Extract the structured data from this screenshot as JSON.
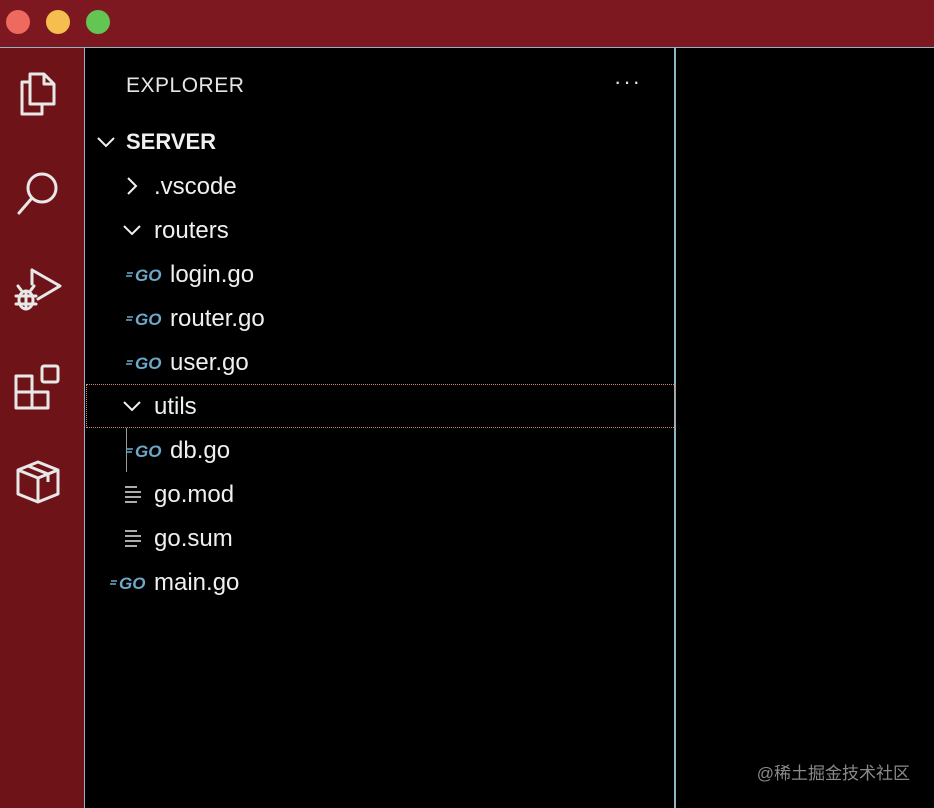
{
  "window": {
    "traffic_lights": [
      "close",
      "minimize",
      "maximize"
    ],
    "colors": {
      "titlebar": "#7d1820",
      "activitybar": "#6e1418",
      "accent_border": "#8fb4c8"
    }
  },
  "activity_bar": {
    "items": [
      {
        "name": "files-icon"
      },
      {
        "name": "search-icon"
      },
      {
        "name": "run-debug-icon"
      },
      {
        "name": "extensions-icon"
      },
      {
        "name": "package-icon"
      }
    ]
  },
  "explorer": {
    "title": "EXPLORER",
    "more_actions": "···",
    "root": {
      "label": "SERVER",
      "expanded": true
    },
    "tree": [
      {
        "label": ".vscode",
        "type": "folder",
        "expanded": false
      },
      {
        "label": "routers",
        "type": "folder",
        "expanded": true
      },
      {
        "label": "login.go",
        "type": "go"
      },
      {
        "label": "router.go",
        "type": "go"
      },
      {
        "label": "user.go",
        "type": "go"
      },
      {
        "label": "utils",
        "type": "folder",
        "expanded": true,
        "selected": true
      },
      {
        "label": "db.go",
        "type": "go"
      },
      {
        "label": "go.mod",
        "type": "text"
      },
      {
        "label": "go.sum",
        "type": "text"
      },
      {
        "label": "main.go",
        "type": "go"
      }
    ]
  },
  "watermark": "@稀土掘金技术社区"
}
